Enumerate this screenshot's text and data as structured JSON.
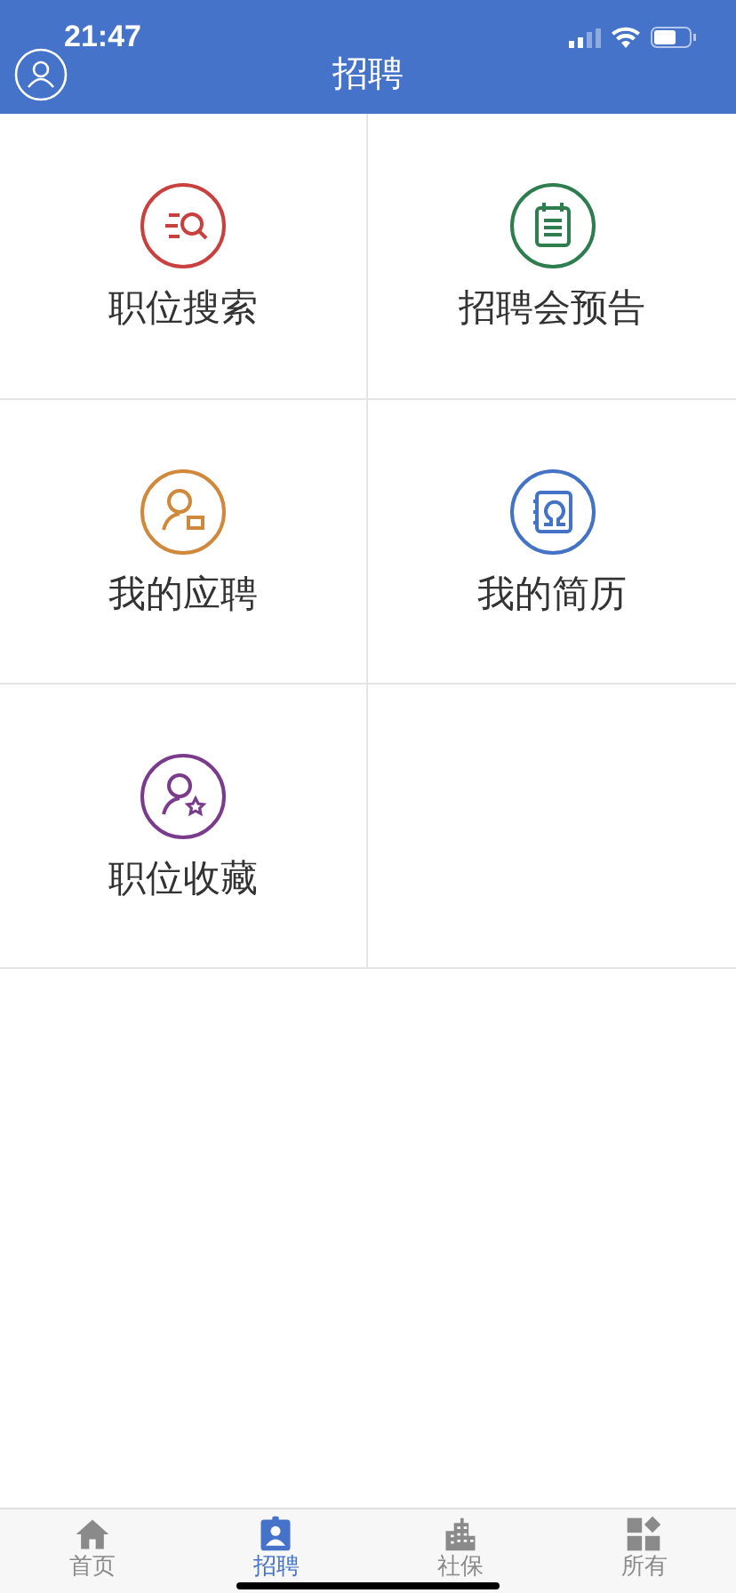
{
  "status_bar": {
    "time": "21:47"
  },
  "header": {
    "title": "招聘"
  },
  "menu": [
    {
      "label": "职位搜索",
      "kind": "search",
      "color": "#c9413f"
    },
    {
      "label": "招聘会预告",
      "kind": "calendar",
      "color": "#2e7d4f"
    },
    {
      "label": "我的应聘",
      "kind": "applicant",
      "color": "#d0893b"
    },
    {
      "label": "我的简历",
      "kind": "resume",
      "color": "#4472c4"
    },
    {
      "label": "职位收藏",
      "kind": "favorite",
      "color": "#7b3b8c"
    }
  ],
  "tabs": [
    {
      "label": "首页",
      "kind": "home",
      "selected": false
    },
    {
      "label": "招聘",
      "kind": "badge",
      "selected": true
    },
    {
      "label": "社保",
      "kind": "building",
      "selected": false
    },
    {
      "label": "所有",
      "kind": "apps",
      "selected": false
    }
  ]
}
